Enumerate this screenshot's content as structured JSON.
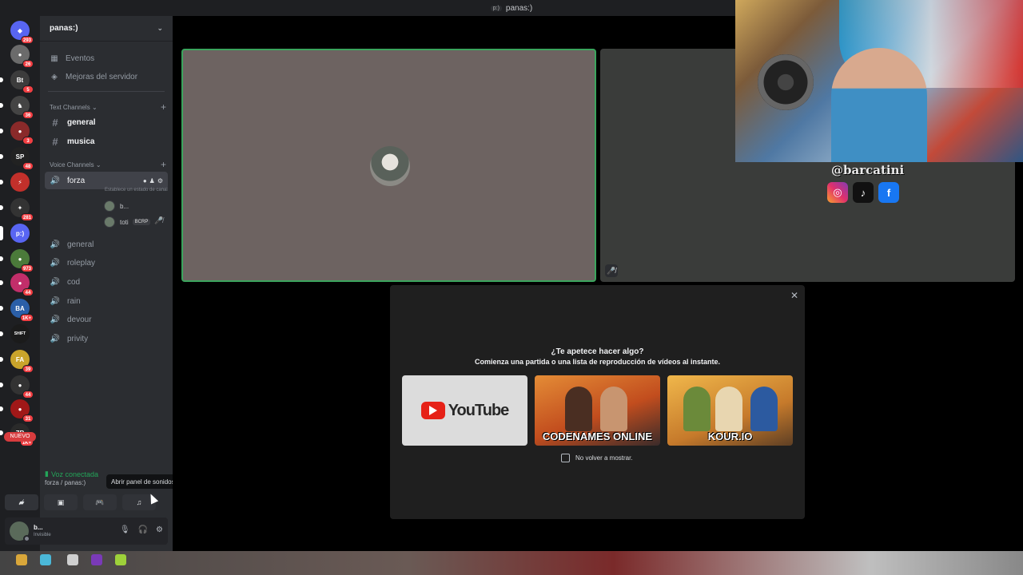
{
  "window": {
    "title": "panas:)",
    "server_mini": "p:)"
  },
  "rail": {
    "servers": [
      {
        "name": "discord",
        "label": "◆",
        "badge": "293",
        "color": "#5865f2"
      },
      {
        "name": "srv2",
        "label": "●",
        "badge": "26",
        "color": "#6b6b6b"
      },
      {
        "name": "srv3",
        "label": "Bt",
        "badge": "5",
        "color": "#3c3c3c"
      },
      {
        "name": "srv4",
        "label": "♞",
        "badge": "36",
        "color": "#444"
      },
      {
        "name": "srv5",
        "label": "●",
        "badge": "3",
        "color": "#8a2a2a"
      },
      {
        "name": "srv6",
        "label": "SP",
        "badge": "48",
        "color": "#222"
      },
      {
        "name": "srv7",
        "label": "⚡",
        "badge": "",
        "color": "#c2302b"
      },
      {
        "name": "srv8",
        "label": "✦",
        "badge": "281",
        "color": "#333"
      },
      {
        "name": "srv9",
        "label": "p:)",
        "badge": "",
        "color": "#5865f2"
      },
      {
        "name": "srv10",
        "label": "●",
        "badge": "973",
        "color": "#4b7a3a"
      },
      {
        "name": "srv11",
        "label": "●",
        "badge": "44",
        "color": "#c22e6a"
      },
      {
        "name": "srv12",
        "label": "BA",
        "badge": "1K+",
        "color": "#2b5fa8"
      },
      {
        "name": "srv13",
        "label": "SHIFT",
        "badge": "",
        "color": "#1b1b1b"
      },
      {
        "name": "srv14",
        "label": "FA",
        "badge": "39",
        "color": "#c9a42b"
      },
      {
        "name": "srv15",
        "label": "●",
        "badge": "44",
        "color": "#333"
      },
      {
        "name": "srv16",
        "label": "●",
        "badge": "31",
        "color": "#a01818"
      },
      {
        "name": "srv17",
        "label": "ZR",
        "badge": "1K+",
        "color": "#2a2a2a"
      }
    ],
    "nuevo": "NUEVO"
  },
  "sidebar": {
    "server_name": "panas:)",
    "events": "Eventos",
    "boosts": "Mejoras del servidor",
    "text_category": "Text Channels",
    "text_channels": [
      "general",
      "musica"
    ],
    "voice_category": "Voice Channels",
    "active_voice": "forza",
    "active_voice_status": "Establece un estado de canal",
    "voice_users": [
      {
        "name": "b...",
        "tag": ""
      },
      {
        "name": "toti",
        "tag": "BCRP"
      }
    ],
    "voice_channels": [
      "general",
      "roleplay",
      "cod",
      "rain",
      "devour",
      "privity"
    ]
  },
  "voice_panel": {
    "status": "Voz conectada",
    "location": "forza / panas:)",
    "tooltip": "Abrir panel de sonidos"
  },
  "user_panel": {
    "name": "b...",
    "state": "Invisible"
  },
  "stream_overlay": {
    "handle": "@barcatini"
  },
  "activity_modal": {
    "title": "¿Te apetece hacer algo?",
    "subtitle": "Comienza una partida o una lista de reproducción de vídeos al instante.",
    "activities": [
      {
        "name": "YouTube"
      },
      {
        "name": "CODENAMES ONLINE"
      },
      {
        "name": "KOUR.IO"
      }
    ],
    "checkbox_label": "No volver a mostrar."
  }
}
